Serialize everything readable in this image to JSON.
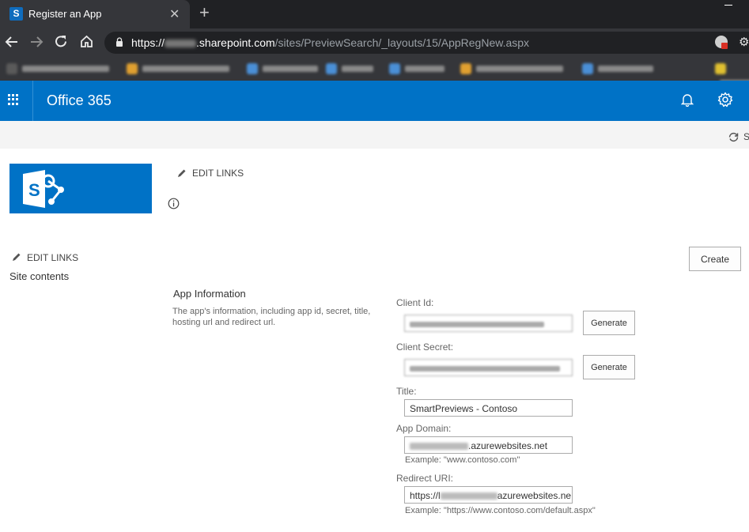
{
  "browser": {
    "tab_title": "Register an App",
    "tab_close": "✕",
    "new_tab": "+",
    "url_scheme": "https://",
    "url_host": ".sharepoint.com",
    "url_path": "/sites/PreviewSearch/_layouts/15/AppRegNew.aspx"
  },
  "suite": {
    "brand": "Office 365"
  },
  "ribbon": {
    "share_label": "S"
  },
  "site": {
    "edit_links": "EDIT LINKS",
    "site_contents": "Site contents",
    "create_label": "Create"
  },
  "form": {
    "section_title": "App Information",
    "section_desc": "The app's information, including app id, secret, title, hosting url and redirect url.",
    "client_id_label": "Client Id:",
    "client_secret_label": "Client Secret:",
    "generate_label": "Generate",
    "title_label": "Title:",
    "title_value": "SmartPreviews - Contoso",
    "app_domain_label": "App Domain:",
    "app_domain_suffix": ".azurewebsites.net",
    "app_domain_example": "Example: \"www.contoso.com\"",
    "redirect_label": "Redirect URI:",
    "redirect_prefix": "https://l",
    "redirect_suffix": "azurewebsites.ne",
    "redirect_example": "Example: \"https://www.contoso.com/default.aspx\""
  },
  "colors": {
    "suite_bar": "#0072c6",
    "browser_chrome": "#35363a",
    "tab_strip": "#202124"
  }
}
